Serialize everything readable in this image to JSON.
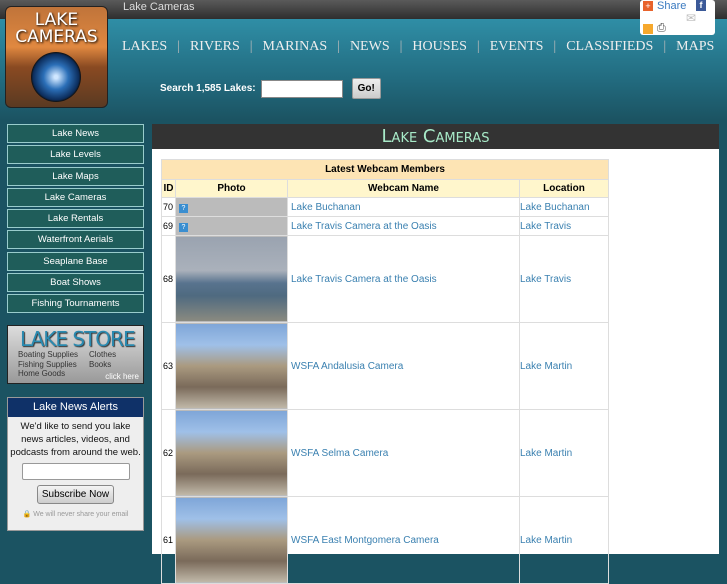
{
  "topbar": {
    "title": "Lake Cameras"
  },
  "logo": {
    "text": "LAKE CAMERAS"
  },
  "nav": [
    "LAKES",
    "RIVERS",
    "MARINAS",
    "NEWS",
    "HOUSES",
    "EVENTS",
    "CLASSIFIEDS",
    "MAPS"
  ],
  "search": {
    "label": "Search 1,585 Lakes:",
    "value": "",
    "button": "Go!"
  },
  "share": {
    "label": "Share"
  },
  "sidebar": [
    "Lake News",
    "Lake Levels",
    "Lake Maps",
    "Lake Cameras",
    "Lake Rentals",
    "Waterfront Aerials",
    "Seaplane Base",
    "Boat Shows",
    "Fishing Tournaments"
  ],
  "store": {
    "title": "LAKE STORE",
    "items": [
      "Boating Supplies",
      "Clothes",
      "Fishing Supplies",
      "Books",
      "Home Goods"
    ],
    "cta": "click here"
  },
  "alerts": {
    "title": "Lake News Alerts",
    "text": "We'd like to send you lake news articles, videos, and podcasts from around the web.",
    "button": "Subscribe Now",
    "note": "We will never share your email"
  },
  "main": {
    "title": "Lake Cameras"
  },
  "table": {
    "caption": "Latest Webcam Members",
    "headers": [
      "ID",
      "Photo",
      "Webcam Name",
      "Location"
    ],
    "rows": [
      {
        "id": "70",
        "name": "Lake Buchanan",
        "location": "Lake Buchanan"
      },
      {
        "id": "69",
        "name": "Lake Travis Camera at the Oasis",
        "location": "Lake Travis"
      },
      {
        "id": "68",
        "name": "Lake Travis Camera at the Oasis",
        "location": "Lake Travis"
      },
      {
        "id": "63",
        "name": "WSFA Andalusia Camera",
        "location": "Lake Martin"
      },
      {
        "id": "62",
        "name": "WSFA Selma Camera",
        "location": "Lake Martin"
      },
      {
        "id": "61",
        "name": "WSFA East Montgomera Camera",
        "location": "Lake Martin"
      }
    ]
  }
}
